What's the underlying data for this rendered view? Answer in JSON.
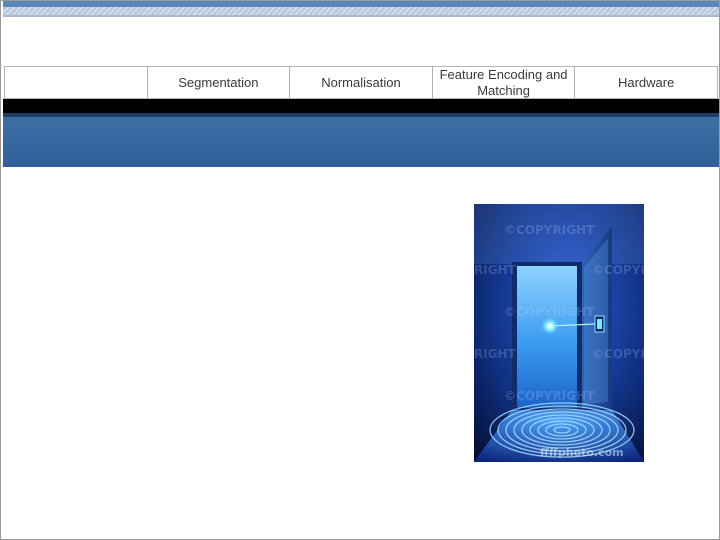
{
  "nav": {
    "items": [
      {
        "label": ""
      },
      {
        "label": "Segmentation"
      },
      {
        "label": "Normalisation"
      },
      {
        "label": "Feature Encoding and Matching"
      },
      {
        "label": "Hardware"
      }
    ]
  },
  "illustration": {
    "watermark": "©COPYRIGHT",
    "watermark_right": "RIGHT",
    "watermark_copr": "©COPYR",
    "credit": "ffffphoto.com",
    "icon": "fingerprint-door-image"
  },
  "colors": {
    "band_blue": "#3668a0",
    "band_black": "#000000",
    "nav_border": "#b4b4b4"
  }
}
